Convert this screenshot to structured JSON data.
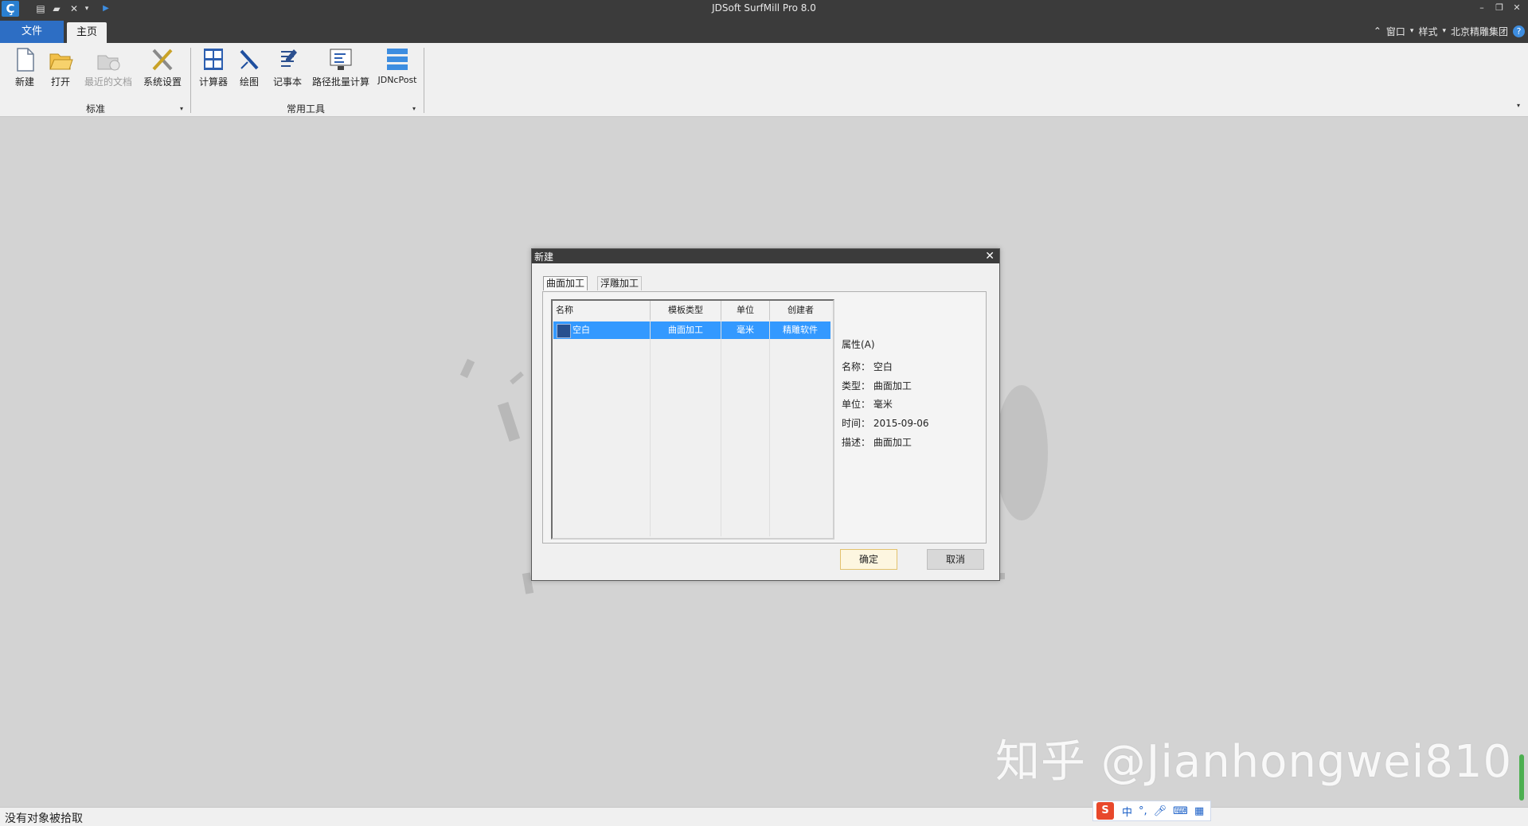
{
  "app": {
    "title": "JDSoft SurfMill Pro 8.0"
  },
  "tabs": {
    "file": "文件",
    "home": "主页"
  },
  "topright": {
    "window": "窗口",
    "style": "样式",
    "company": "北京精雕集团",
    "help": "?"
  },
  "ribbon": {
    "groups": [
      {
        "label": "标准",
        "items": [
          "新建",
          "打开",
          "最近的文档",
          "系统设置"
        ]
      },
      {
        "label": "常用工具",
        "items": [
          "计算器",
          "绘图",
          "记事本",
          "路径批量计算",
          "JDNcPost"
        ]
      }
    ]
  },
  "dialog": {
    "title": "新建",
    "close": "✕",
    "tabs": [
      "曲面加工",
      "浮雕加工"
    ],
    "columns": [
      "名称",
      "模板类型",
      "单位",
      "创建者"
    ],
    "rows": [
      {
        "name": "空白",
        "type": "曲面加工",
        "unit": "毫米",
        "creator": "精雕软件"
      }
    ],
    "properties": {
      "header": "属性(A)",
      "name": "名称： 空白",
      "type": "类型： 曲面加工",
      "unit": "单位： 毫米",
      "time": "时间： 2015-09-06",
      "desc": "描述： 曲面加工"
    },
    "ok": "确定",
    "cancel": "取消"
  },
  "status": {
    "text": "没有对象被拾取"
  },
  "ime": {
    "logo": "S",
    "mode": "中"
  },
  "watermark": "知乎 @Jianhongwei810",
  "colors": {
    "accent": "#2d6ec4",
    "selection": "#3399ff",
    "titlebar": "#3b3b3b"
  }
}
